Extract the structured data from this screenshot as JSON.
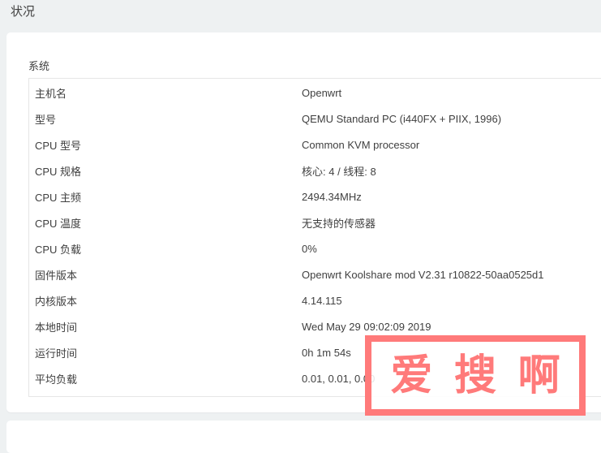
{
  "page": {
    "title": "状况"
  },
  "system": {
    "section_title": "系统",
    "rows": [
      {
        "label": "主机名",
        "value": "Openwrt"
      },
      {
        "label": "型号",
        "value": "QEMU Standard PC (i440FX + PIIX, 1996)"
      },
      {
        "label": "CPU 型号",
        "value": "Common KVM processor"
      },
      {
        "label": "CPU 规格",
        "value": "核心: 4 / 线程: 8"
      },
      {
        "label": "CPU 主频",
        "value": "2494.34MHz"
      },
      {
        "label": "CPU 温度",
        "value": "无支持的传感器"
      },
      {
        "label": "CPU 负载",
        "value": "0%"
      },
      {
        "label": "固件版本",
        "value": "Openwrt Koolshare mod V2.31 r10822-50aa0525d1"
      },
      {
        "label": "内核版本",
        "value": "4.14.115"
      },
      {
        "label": "本地时间",
        "value": "Wed May 29 09:02:09 2019"
      },
      {
        "label": "运行时间",
        "value": "0h 1m 54s"
      },
      {
        "label": "平均负载",
        "value": "0.01, 0.01, 0.00"
      }
    ]
  },
  "watermark": {
    "chars": [
      "爱",
      "搜",
      "啊"
    ],
    "color": "#ff7a7a"
  }
}
